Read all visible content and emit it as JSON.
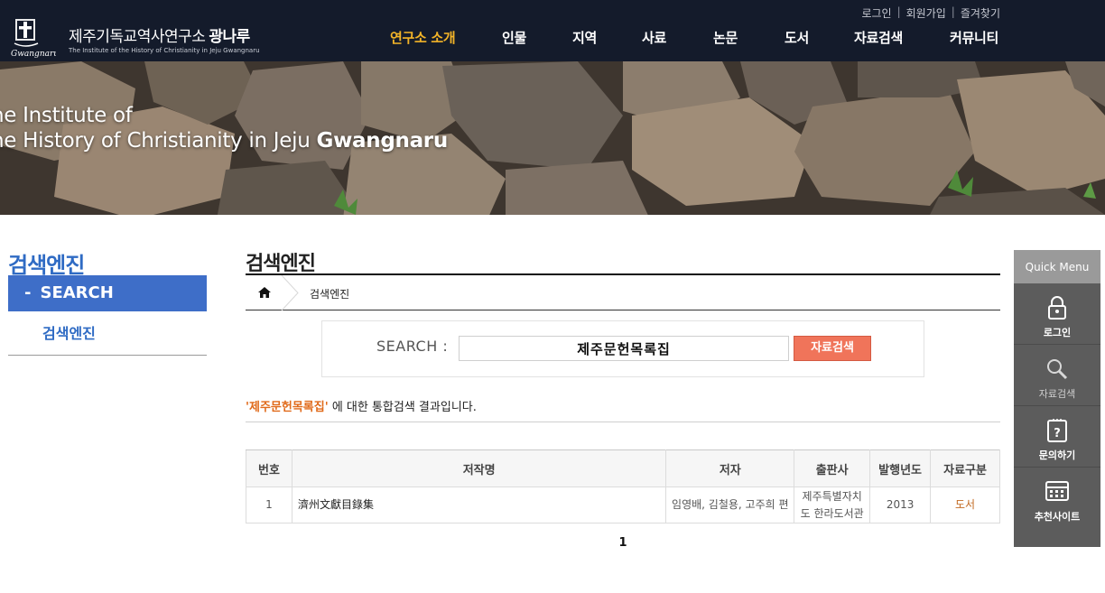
{
  "header": {
    "logo_title": "제주기독교역사연구소",
    "logo_title_bold": "광나루",
    "logo_subtitle": "The Institute of the History of Christianity in Jeju Gwangnaru",
    "utility": [
      "로그인",
      "회원가입",
      "즐겨찾기"
    ],
    "nav": [
      "연구소 소개",
      "인물",
      "지역",
      "사료",
      "논문",
      "도서",
      "자료검색",
      "커뮤니티"
    ],
    "active_nav_color": "#f3b428"
  },
  "banner": {
    "line1": "he Institute of",
    "line2": "he History of Christianity in Jeju",
    "line2_bold": "Gwangnaru"
  },
  "sidebar": {
    "title": "검색엔진",
    "active_item": "SEARCH",
    "sub_item": "검색엔진",
    "accent_color": "#3e6ec8"
  },
  "main": {
    "page_title": "검색엔진",
    "breadcrumb": "검색엔진",
    "search": {
      "label": "SEARCH :",
      "value": "제주문헌목록집",
      "button": "자료검색"
    },
    "result_keyword": "'제주문헌목록집'",
    "result_suffix": " 에 대한 통합검색 결과입니다.",
    "table": {
      "headers": [
        "번호",
        "저작명",
        "저자",
        "출판사",
        "발행년도",
        "자료구분"
      ],
      "rows": [
        [
          "1",
          "濟州文獻目錄集",
          "임영배, 김철용, 고주희 편",
          "제주특별자치도 한라도서관",
          "2013",
          "도서"
        ]
      ]
    },
    "pagination": "1"
  },
  "quick_menu": {
    "title": "Quick Menu",
    "items": [
      {
        "label": "로그인",
        "icon": "lock-icon"
      },
      {
        "label": "자료검색",
        "icon": "search-icon"
      },
      {
        "label": "문의하기",
        "icon": "question-icon"
      },
      {
        "label": "추천사이트",
        "icon": "calendar-icon"
      }
    ]
  }
}
